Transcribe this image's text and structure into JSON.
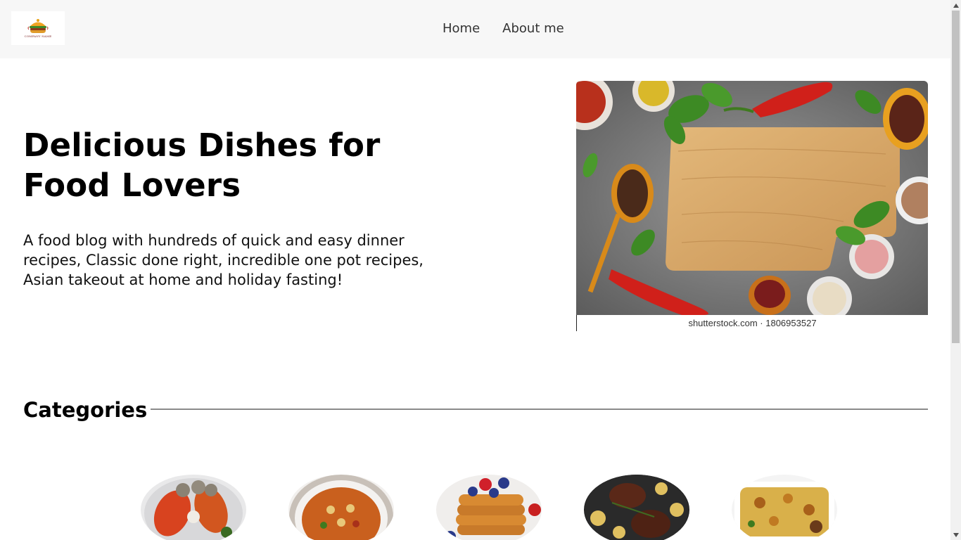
{
  "header": {
    "logo_text": "COMPANY NAME",
    "nav": [
      {
        "label": "Home"
      },
      {
        "label": "About me"
      }
    ]
  },
  "hero": {
    "title": "Delicious Dishes for Food Lovers",
    "description": "A food blog with hundreds of quick and easy dinner recipes, Classic done right, incredible one pot recipes, Asian takeout at home and holiday fasting!",
    "image_caption": "shutterstock.com · 1806953527"
  },
  "categories": {
    "heading": "Categories",
    "items": [
      {
        "icon": "seafood-platter"
      },
      {
        "icon": "soup-bowl"
      },
      {
        "icon": "pancake-stack"
      },
      {
        "icon": "grilled-steak"
      },
      {
        "icon": "baked-casserole"
      }
    ]
  },
  "colors": {
    "header_bg": "#f7f7f7",
    "text": "#111111",
    "rule": "#8a8a8a"
  }
}
